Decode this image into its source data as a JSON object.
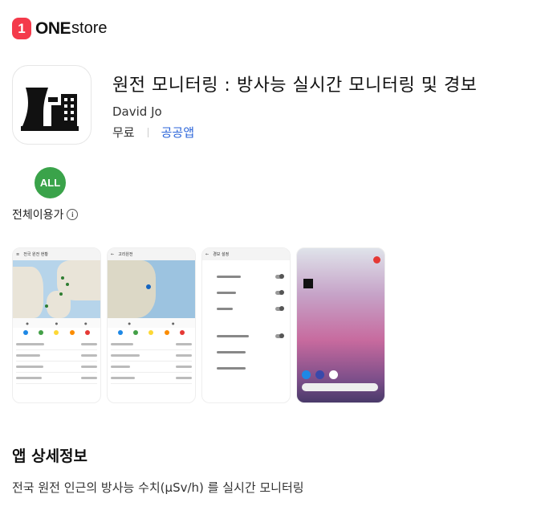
{
  "store": {
    "logo_badge": "1",
    "logo_one": "ONE",
    "logo_store": "store"
  },
  "app": {
    "title": "원전 모니터링 : 방사능 실시간 모니터링 및 경보",
    "developer": "David Jo",
    "price": "무료",
    "category": "공공앱",
    "icon": "nuclear-plant-icon"
  },
  "rating": {
    "badge": "ALL",
    "label": "전체이용가"
  },
  "screenshots": {
    "s1": {
      "title": "전국 원전 현황"
    },
    "s2": {
      "title": "고리원전"
    },
    "s3": {
      "title": "경보 설정"
    }
  },
  "details": {
    "heading": "앱 상세정보",
    "description": "전국 원전 인근의 방사능 수치(μSv/h) 를 실시간 모니터링"
  },
  "colors": {
    "brand": "#f43a4b",
    "age_badge": "#3aa34a",
    "link": "#2b65d9"
  }
}
